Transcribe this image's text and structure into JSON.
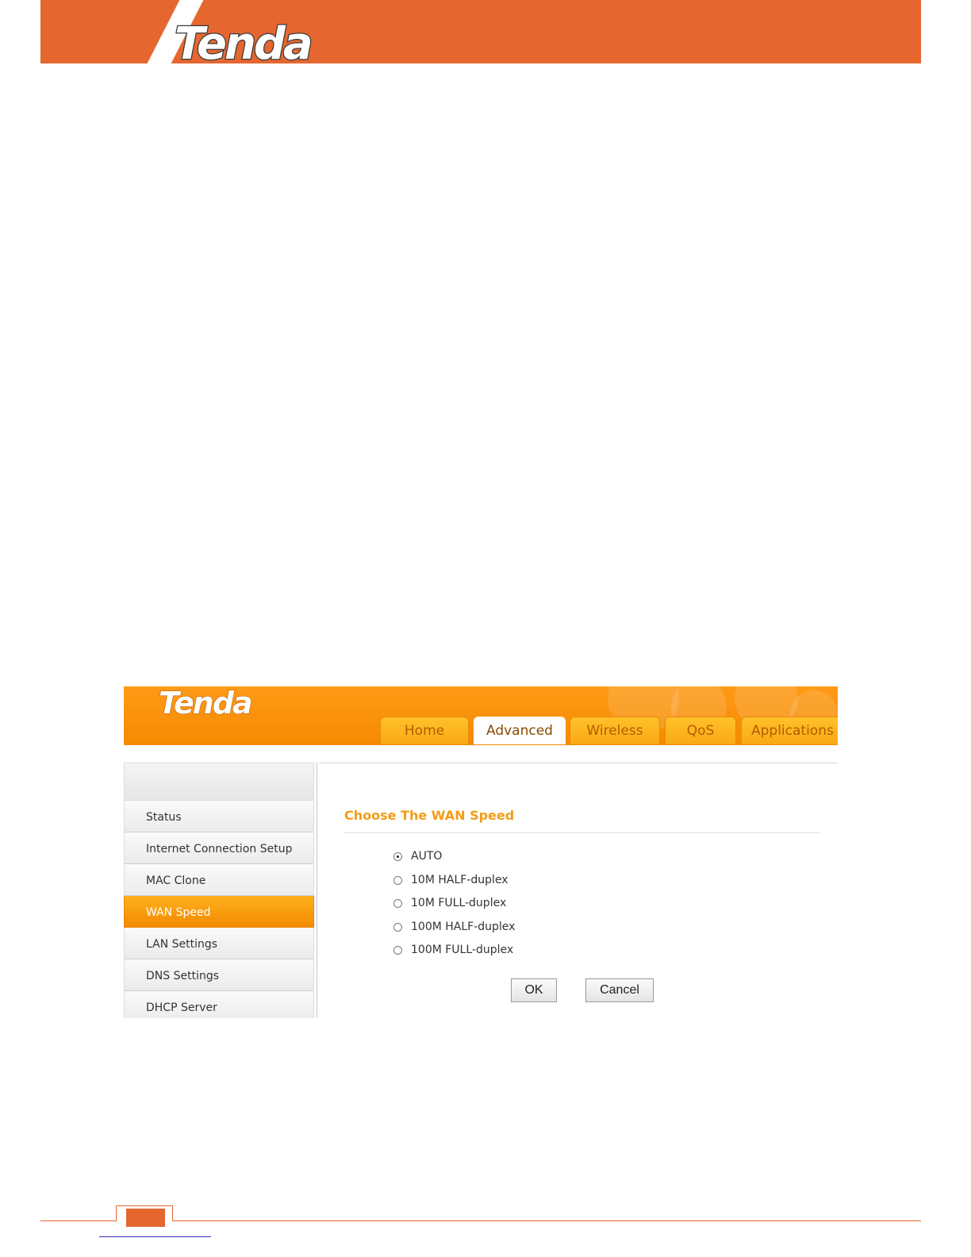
{
  "page_header": {
    "logo_text": "Tenda",
    "banner_color": "#e5672f"
  },
  "router_ui": {
    "logo_text": "Tenda",
    "header_color": "#f7920a",
    "tabs": [
      {
        "label": "Home",
        "active": false
      },
      {
        "label": "Advanced",
        "active": true
      },
      {
        "label": "Wireless",
        "active": false
      },
      {
        "label": "QoS",
        "active": false
      },
      {
        "label": "Applications",
        "active": false
      }
    ],
    "sidebar": {
      "items": [
        {
          "label": "Status",
          "active": false
        },
        {
          "label": "Internet Connection Setup",
          "active": false
        },
        {
          "label": "MAC Clone",
          "active": false
        },
        {
          "label": "WAN Speed",
          "active": true
        },
        {
          "label": "LAN Settings",
          "active": false
        },
        {
          "label": "DNS Settings",
          "active": false
        },
        {
          "label": "DHCP Server",
          "active": false
        }
      ]
    },
    "content": {
      "section_title": "Choose The WAN Speed",
      "title_color": "#f39c18",
      "speed_options": [
        {
          "label": "AUTO",
          "selected": true
        },
        {
          "label": "10M HALF-duplex",
          "selected": false
        },
        {
          "label": "10M FULL-duplex",
          "selected": false
        },
        {
          "label": "100M HALF-duplex",
          "selected": false
        },
        {
          "label": "100M FULL-duplex",
          "selected": false
        }
      ],
      "ok_label": "OK",
      "cancel_label": "Cancel"
    }
  }
}
